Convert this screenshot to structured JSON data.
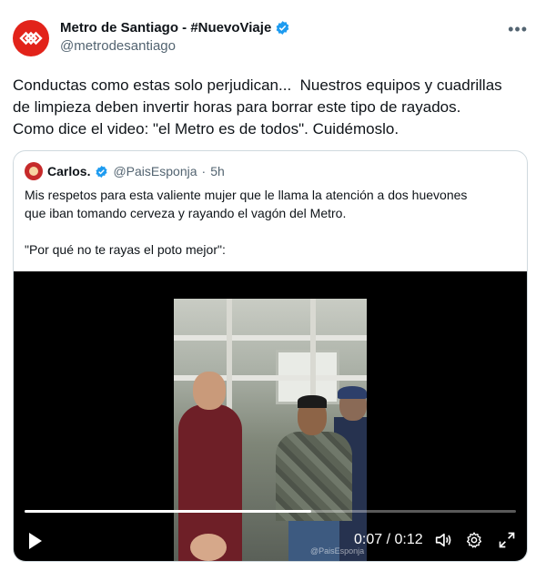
{
  "tweet": {
    "display_name": "Metro de Santiago - #NuevoViaje",
    "handle": "@metrodesantiago",
    "brand_color": "#e2231a",
    "verified_color": "#1d9bf0",
    "more_icon": "more-icon",
    "text_lines": [
      "Conductas como estas solo perjudican...  Nuestros equipos y cuadrillas",
      "de limpieza deben invertir horas para borrar este tipo de rayados.",
      "Como dice el video: \"el Metro es de todos\". Cuidémoslo."
    ]
  },
  "quoted_tweet": {
    "display_name": "Carlos.",
    "handle": "@PaisEsponja",
    "separator": "·",
    "time": "5h",
    "text_lines": [
      "Mis respetos para esta valiente mujer que le llama la atención a dos huevones",
      "que iban tomando cerveza y rayando el vagón del Metro.",
      "",
      "\"Por qué no te rayas el poto mejor\":"
    ]
  },
  "video": {
    "current_time": "0:07",
    "separator": " / ",
    "duration": "0:12",
    "progress_fraction": 0.583,
    "watermark": "@PaisEsponja",
    "controls": [
      "play-icon",
      "volume-icon",
      "gear-icon",
      "fullscreen-icon"
    ]
  }
}
